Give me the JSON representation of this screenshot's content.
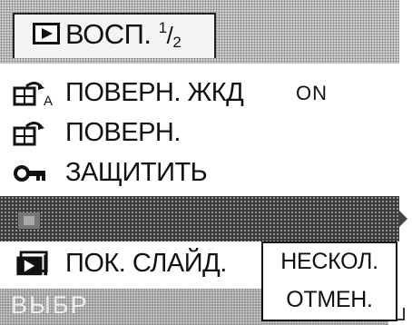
{
  "header": {
    "title": "ВОСП.",
    "page_num": "1",
    "page_den": "2",
    "icon": "play-icon"
  },
  "menu": {
    "items": [
      {
        "label": "ПОВЕРН. ЖКД",
        "value": "ON",
        "icon": "rotate-lcd-icon"
      },
      {
        "label": "ПОВЕРН.",
        "value": "",
        "icon": "rotate-icon"
      },
      {
        "label": "ЗАЩИТИТЬ",
        "value": "",
        "icon": "key-icon"
      },
      {
        "label": "",
        "value": "",
        "icon": "highlighted-item-icon",
        "selected": true
      },
      {
        "label": "ПОК. СЛАЙД.",
        "value": "",
        "icon": "slideshow-icon"
      }
    ]
  },
  "popup": {
    "options": [
      "НЕСКОЛ.",
      "ОТМЕН."
    ]
  },
  "footer": {
    "label": "ВЫБР"
  },
  "colors": {
    "selection": "#3a3a3a",
    "header_pattern": "#dcdcdc",
    "text": "#111111",
    "background": "#ffffff"
  }
}
